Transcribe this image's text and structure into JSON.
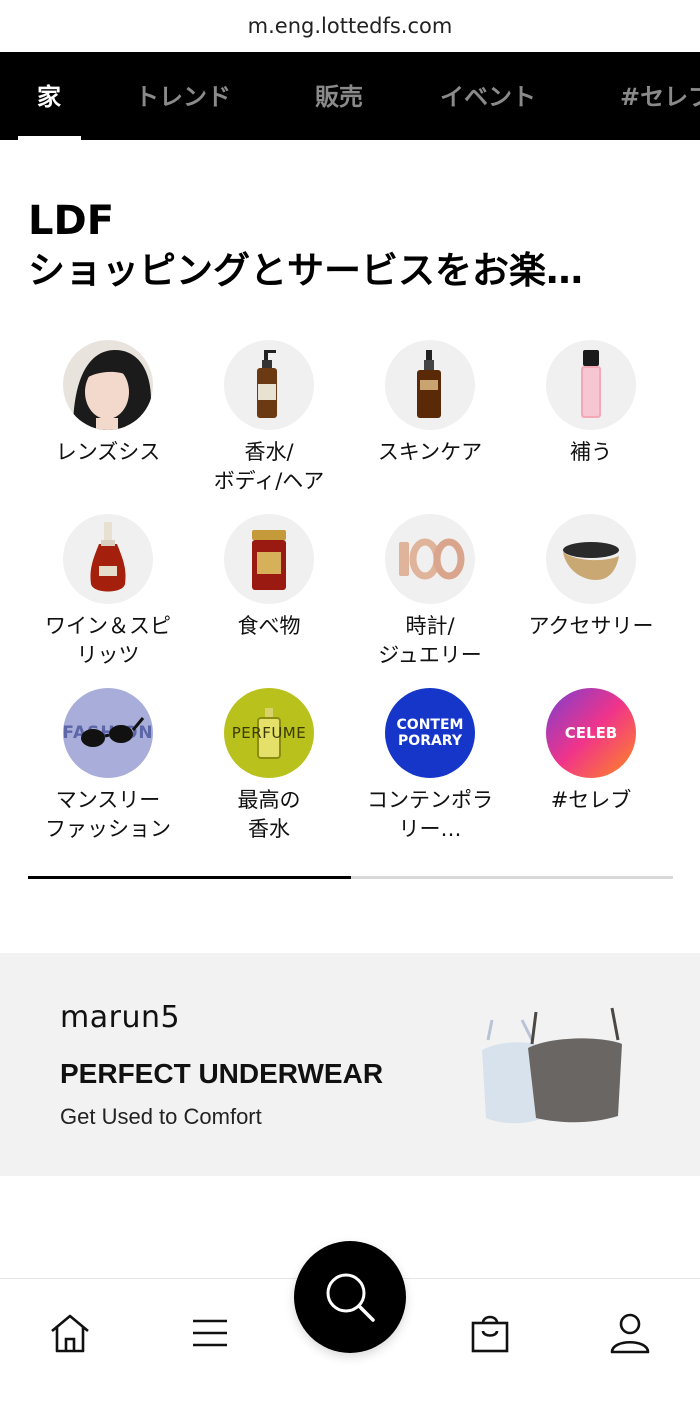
{
  "browser": {
    "url": "m.eng.lottedfs.com"
  },
  "tabs": [
    {
      "label": "家"
    },
    {
      "label": "トレンド"
    },
    {
      "label": "販売"
    },
    {
      "label": "イベント"
    },
    {
      "label": "#セレブ"
    }
  ],
  "headline": {
    "line1": "LDF",
    "line2": "ショッピングとサービスをお楽…"
  },
  "categories": [
    {
      "label": "レンズシス",
      "icon": "model-photo"
    },
    {
      "label": "香水/\nボディ/ヘア",
      "icon": "pump-bottle"
    },
    {
      "label": "スキンケア",
      "icon": "serum-bottle"
    },
    {
      "label": "補う",
      "icon": "lip-gloss"
    },
    {
      "label": "ワイン＆スピ\nリッツ",
      "icon": "cognac-bottle"
    },
    {
      "label": "食べ物",
      "icon": "ginseng-jar"
    },
    {
      "label": "時計/\nジュエリー",
      "icon": "gold-rings"
    },
    {
      "label": "アクセサリー",
      "icon": "sun-visor"
    },
    {
      "label": "マンスリー\nファッション",
      "icon": "sunglasses",
      "badge": "FASHION"
    },
    {
      "label": "最高の\n香水",
      "icon": "perfume-bottle",
      "badge": "PERFUME"
    },
    {
      "label": "コンテンポラ\nリー…",
      "icon": "contemporary-badge",
      "badge": "CONTEM\nPORARY"
    },
    {
      "label": "#セレブ",
      "icon": "celeb-badge",
      "badge": "CELEB"
    }
  ],
  "carousel_progress": 0.5,
  "banner": {
    "brand": "marun5",
    "title": "PERFECT UNDERWEAR",
    "subtitle": "Get Used to Comfort"
  },
  "bottom_nav": {
    "items": [
      "home-icon",
      "menu-icon",
      "search-icon",
      "shopping-bag-icon",
      "user-icon"
    ]
  },
  "colors": {
    "tab_bar": "#000000",
    "tab_inactive": "#8a8a8a",
    "banner_bg": "#f2f2f2",
    "contemporary": "#1536c8",
    "perfume": "#b9c11c",
    "fashion": "#a8aed9"
  }
}
